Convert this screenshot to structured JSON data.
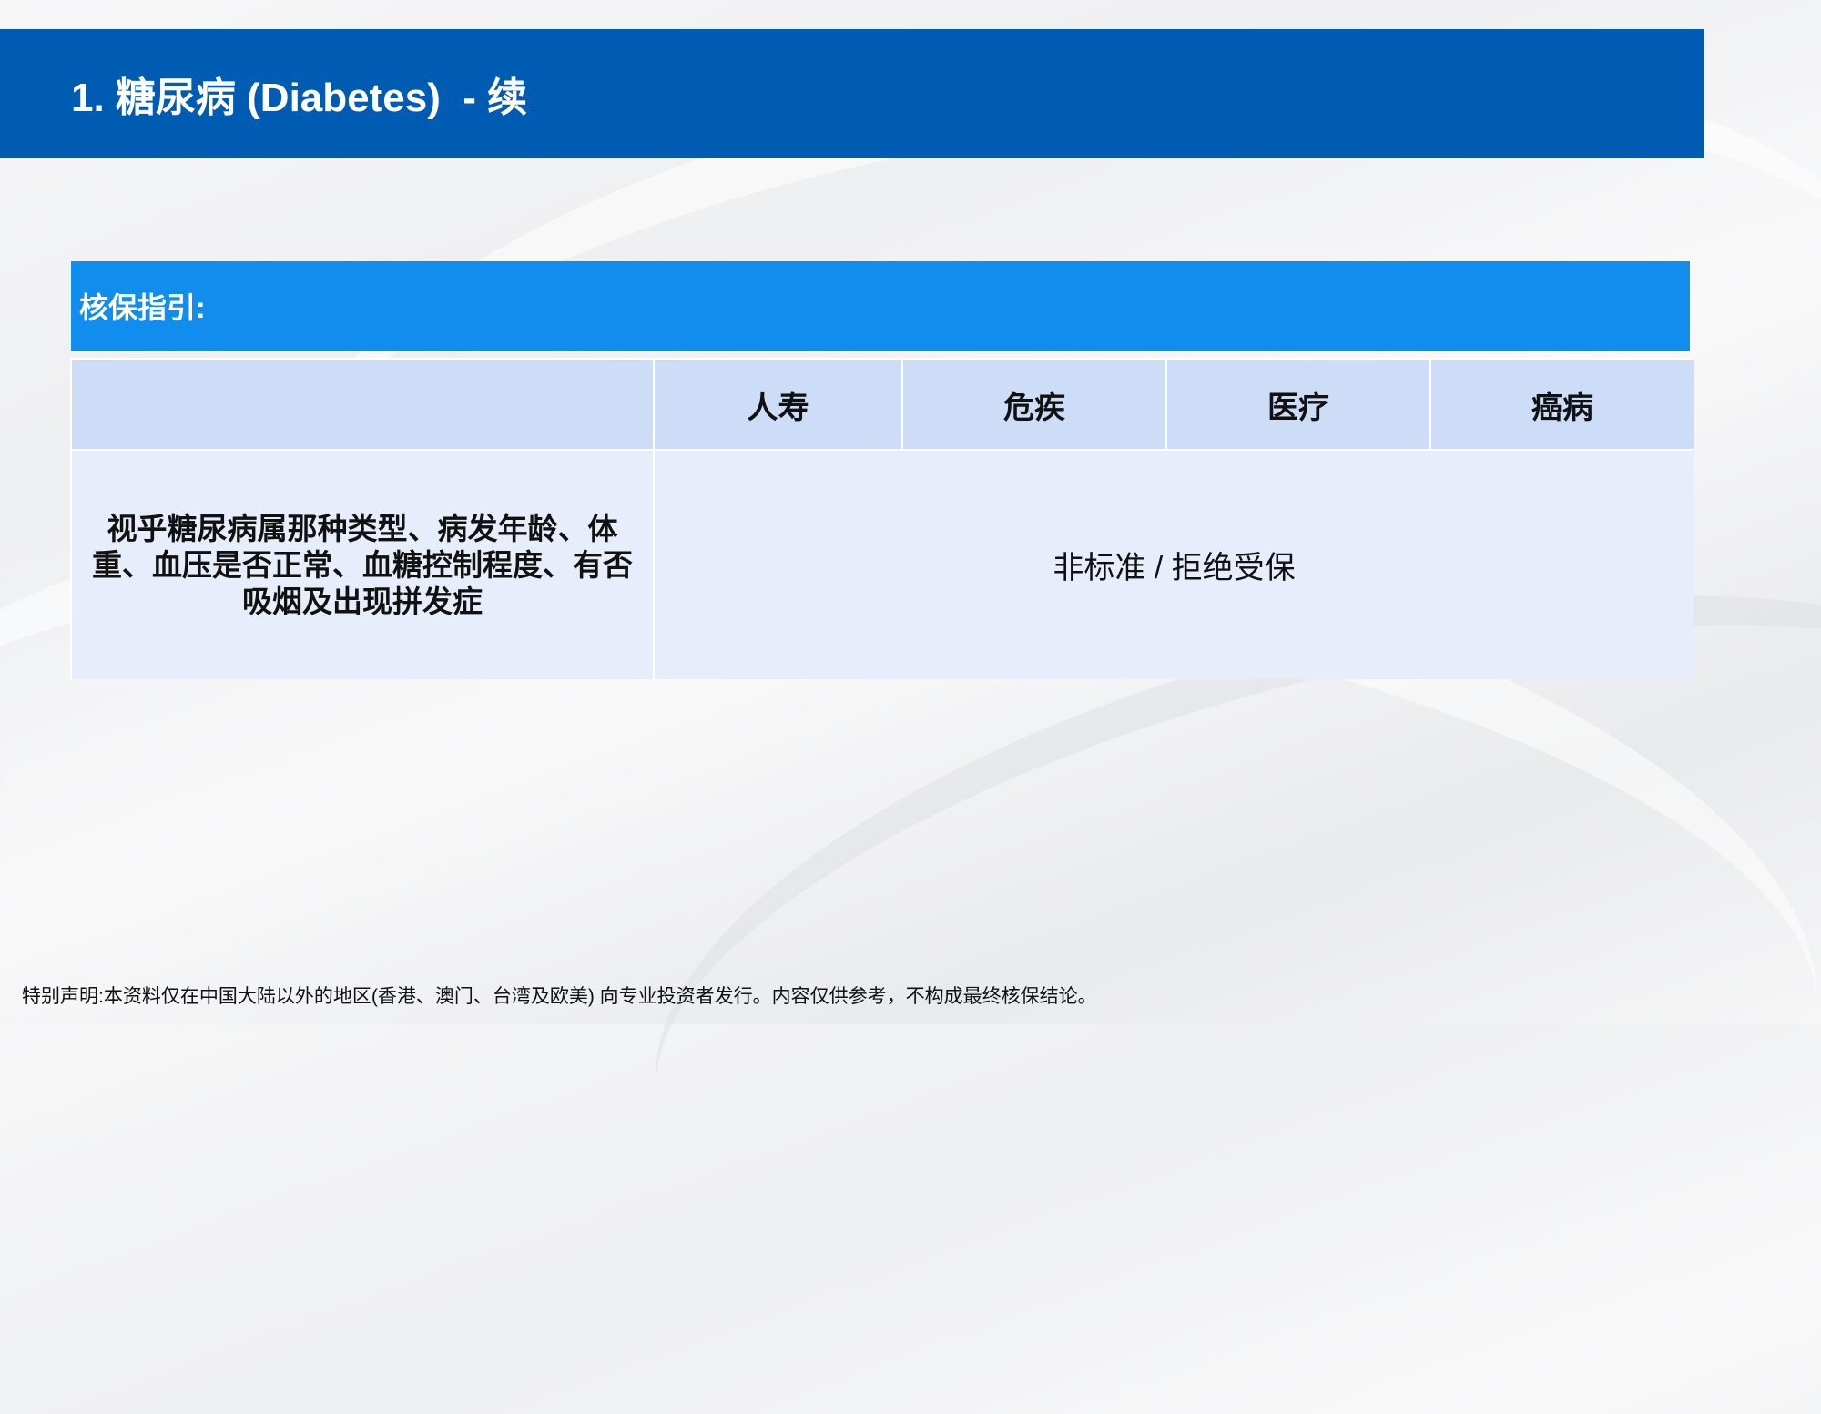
{
  "header": {
    "title": "1. 糖尿病 (Diabetes)  - 续"
  },
  "section": {
    "label": "核保指引:"
  },
  "table": {
    "columns": [
      "",
      "人寿",
      "危疾",
      "医疗",
      "癌病"
    ],
    "rows": [
      {
        "condition": "视乎糖尿病属那种类型、病发年龄、体重、血压是否正常、血糖控制程度、有否吸烟及出现拼发症",
        "decision": "非标准 / 拒绝受保"
      }
    ]
  },
  "footer": {
    "disclaimer": "特别声明:本资料仅在中国大陆以外的地区(香港、澳门、台湾及欧美) 向专业投资者发行。内容仅供参考，不构成最终核保结论。"
  },
  "colors": {
    "title_bar": "#005bb3",
    "section_bar": "#108ded",
    "header_cell": "#cddcf7",
    "body_cell": "#e7edfa"
  }
}
